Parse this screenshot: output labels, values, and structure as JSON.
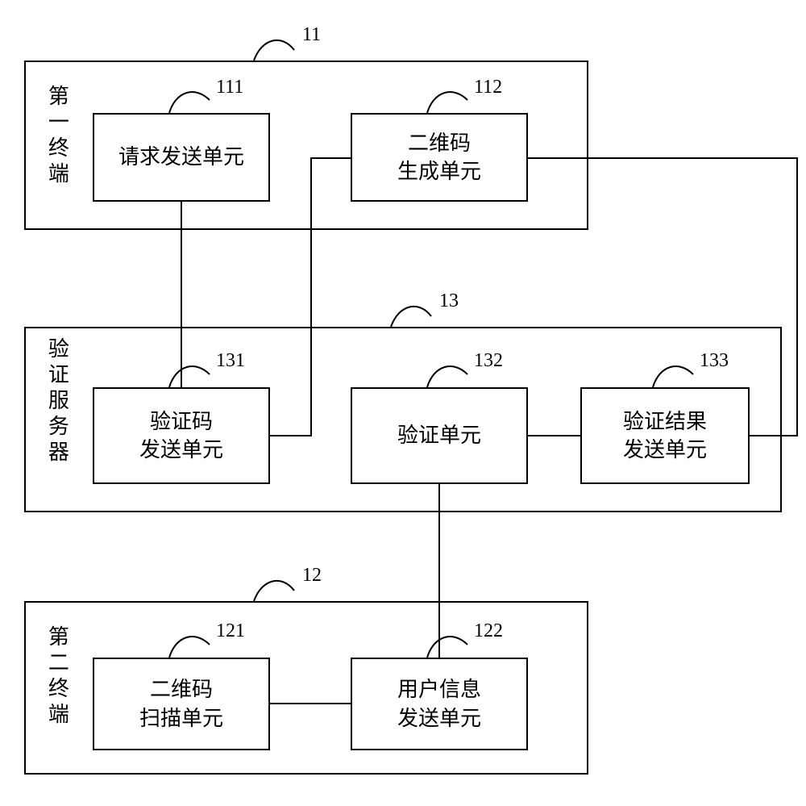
{
  "groups": {
    "g11": {
      "ref": "11",
      "label": "第一终端"
    },
    "g13": {
      "ref": "13",
      "label": "验证服务器"
    },
    "g12": {
      "ref": "12",
      "label": "第二终端"
    }
  },
  "units": {
    "u111": {
      "ref": "111",
      "label": "请求发送单元"
    },
    "u112": {
      "ref": "112",
      "label": "二维码\n生成单元"
    },
    "u131": {
      "ref": "131",
      "label": "验证码\n发送单元"
    },
    "u132": {
      "ref": "132",
      "label": "验证单元"
    },
    "u133": {
      "ref": "133",
      "label": "验证结果\n发送单元"
    },
    "u121": {
      "ref": "121",
      "label": "二维码\n扫描单元"
    },
    "u122": {
      "ref": "122",
      "label": "用户信息\n发送单元"
    }
  }
}
